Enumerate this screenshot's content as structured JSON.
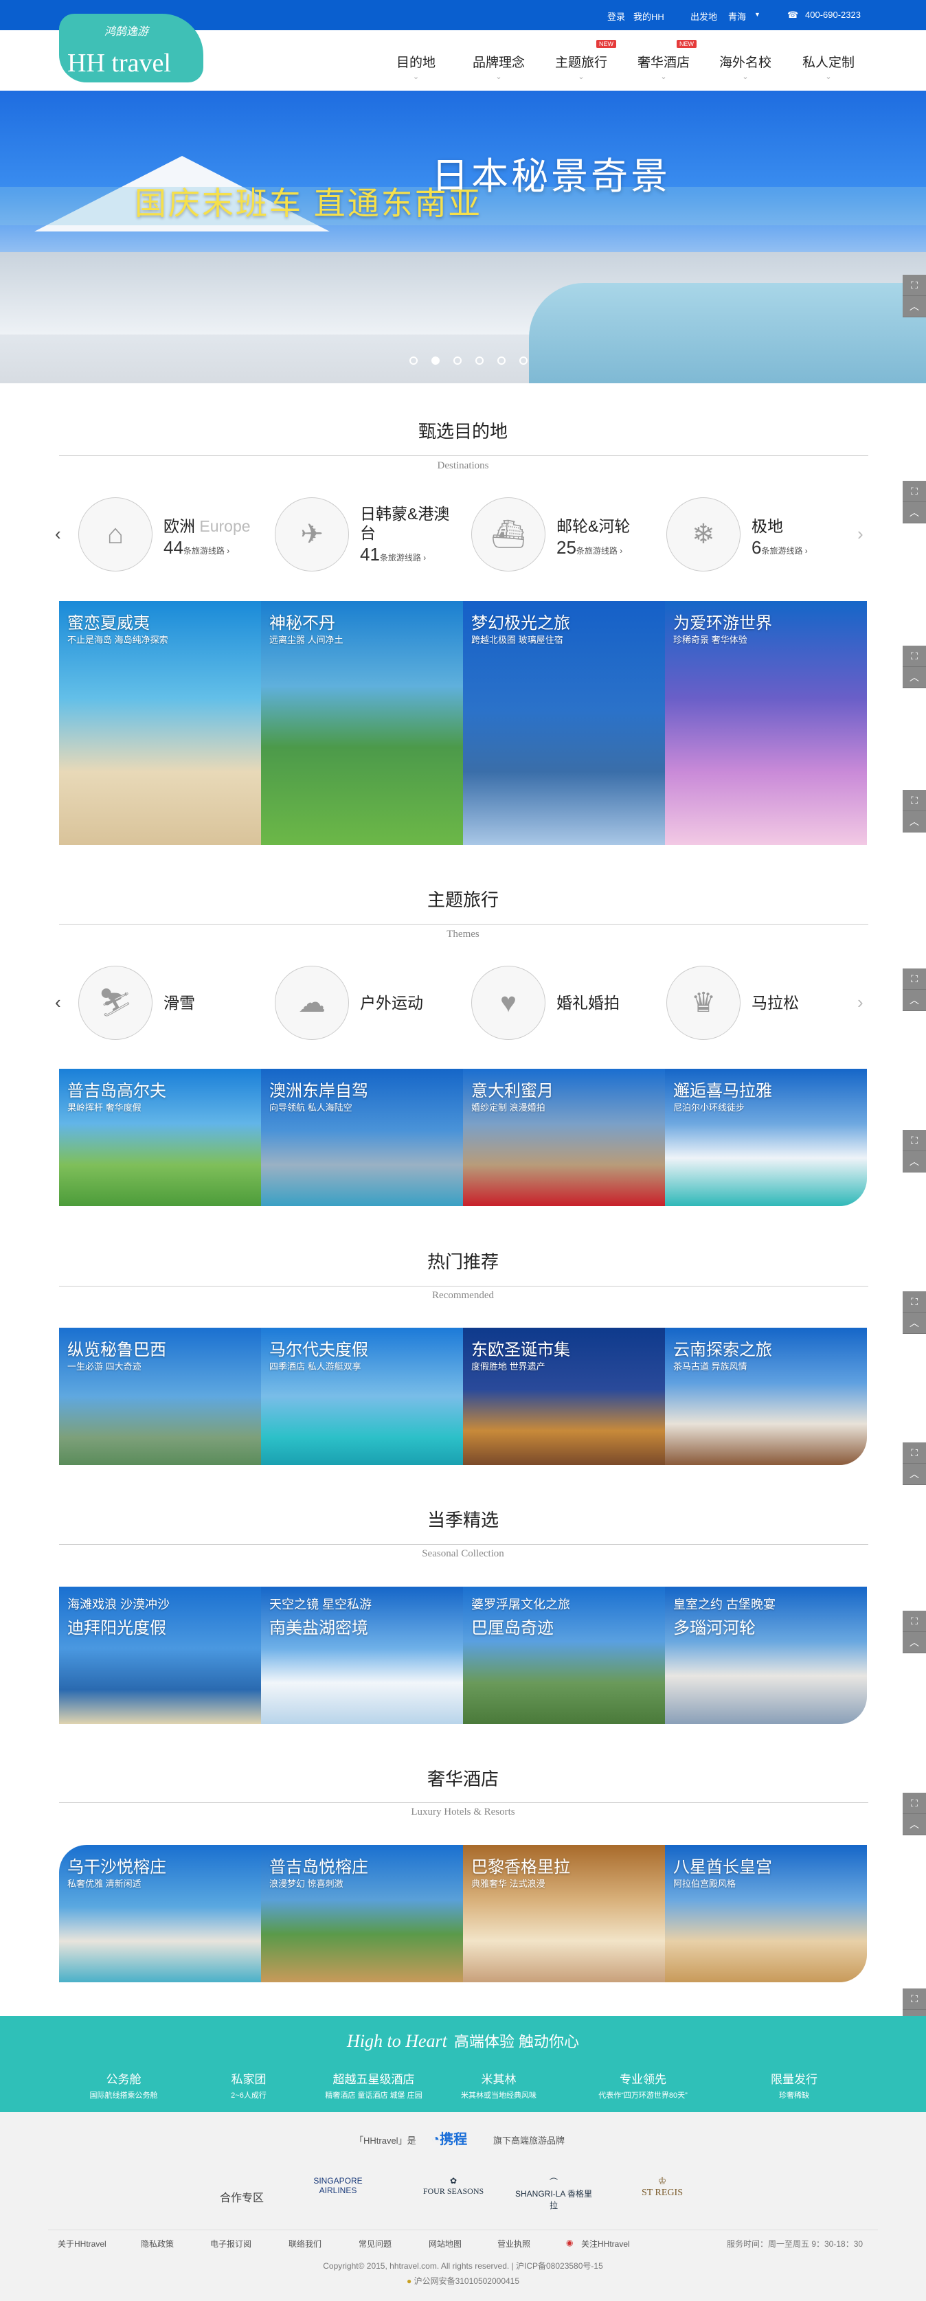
{
  "header": {
    "login": "登录",
    "my_hh": "我的HH",
    "departure": "出发地",
    "city": "青海",
    "phone": "400-690-2323",
    "logo_cn": "鸿鹄逸游",
    "logo_en": "HH travel",
    "badge": "NEW"
  },
  "nav": [
    "目的地",
    "品牌理念",
    "主题旅行",
    "奢华酒店",
    "海外名校",
    "私人定制"
  ],
  "banner": {
    "title": "日本秘景奇景",
    "subtitle": "国庆末班车  直通东南亚"
  },
  "sections": {
    "dest": {
      "title": "甄选目的地",
      "sub": "Destinations"
    },
    "theme": {
      "title": "主题旅行",
      "sub": "Themes"
    },
    "rec": {
      "title": "热门推荐",
      "sub": "Recommended"
    },
    "season": {
      "title": "当季精选",
      "sub": "Seasonal Collection"
    },
    "hotel": {
      "title": "奢华酒店",
      "sub": "Luxury Hotels & Resorts"
    }
  },
  "dest_cats": [
    {
      "name": "欧洲",
      "en": "Europe",
      "count": "44",
      "unit": "条旅游线路 ›"
    },
    {
      "name": "日韩蒙&港澳台",
      "en": "",
      "count": "41",
      "unit": "条旅游线路 ›"
    },
    {
      "name": "邮轮&河轮",
      "en": "",
      "count": "25",
      "unit": "条旅游线路 ›"
    },
    {
      "name": "极地",
      "en": "",
      "count": "6",
      "unit": "条旅游线路 ›"
    }
  ],
  "dest_tiles": [
    {
      "t": "蜜恋夏威夷",
      "s": "不止是海岛 海岛纯净探索"
    },
    {
      "t": "神秘不丹",
      "s": "远离尘嚣 人间净土"
    },
    {
      "t": "梦幻极光之旅",
      "s": "跨越北极圈 玻璃屋住宿"
    },
    {
      "t": "为爱环游世界",
      "s": "珍稀奇景 奢华体验"
    }
  ],
  "theme_cats": [
    "滑雪",
    "户外运动",
    "婚礼婚拍",
    "马拉松"
  ],
  "theme_tiles": [
    {
      "t": "普吉岛高尔夫",
      "s": "果岭挥杆 奢华度假"
    },
    {
      "t": "澳洲东岸自驾",
      "s": "向导领航 私人海陆空"
    },
    {
      "t": "意大利蜜月",
      "s": "婚纱定制 浪漫婚拍"
    },
    {
      "t": "邂逅喜马拉雅",
      "s": "尼泊尔小环线徒步"
    }
  ],
  "rec_tiles": [
    {
      "t": "纵览秘鲁巴西",
      "s": "一生必游 四大奇迹"
    },
    {
      "t": "马尔代夫度假",
      "s": "四季酒店 私人游艇双享"
    },
    {
      "t": "东欧圣诞市集",
      "s": "度假胜地 世界遗产"
    },
    {
      "t": "云南探索之旅",
      "s": "茶马古道 异族风情"
    }
  ],
  "season_tiles": [
    {
      "s": "海滩戏浪 沙漠冲沙",
      "t": "迪拜阳光度假"
    },
    {
      "s": "天空之镜 星空私游",
      "t": "南美盐湖密境"
    },
    {
      "s": "婆罗浮屠文化之旅",
      "t": "巴厘岛奇迹"
    },
    {
      "s": "皇室之约 古堡晚宴",
      "t": "多瑙河河轮"
    }
  ],
  "hotel_tiles": [
    {
      "t": "乌干沙悦榕庄",
      "s": "私奢优雅 清新闲适"
    },
    {
      "t": "普吉岛悦榕庄",
      "s": "浪漫梦幻 惊喜刺激"
    },
    {
      "t": "巴黎香格里拉",
      "s": "典雅奢华 法式浪漫"
    },
    {
      "t": "八星酋长皇宫",
      "s": "阿拉伯宫殿风格"
    }
  ],
  "band": {
    "slogan_en": "High  to  Heart",
    "slogan_cn": "高端体验  触动你心",
    "features": [
      {
        "a": "公务舱",
        "b": "国际航线搭乘公务舱"
      },
      {
        "a": "私家团",
        "b": "2~6人成行"
      },
      {
        "a": "超越五星级酒店",
        "b": "精奢酒店 童话酒店 城堡 庄园"
      },
      {
        "a": "米其林",
        "b": "米其林或当地经典风味"
      },
      {
        "a": "专业领先",
        "b": "代表作“四万环游世界80天”"
      },
      {
        "a": "限量发行",
        "b": "珍奢稀缺"
      }
    ]
  },
  "footer": {
    "ctrip_pre": "「HHtravel」是",
    "ctrip": "携程",
    "ctrip_post": "旗下高端旅游品牌",
    "partners_label": "合作专区",
    "partners": [
      "SINGAPORE AIRLINES",
      "FOUR SEASONS",
      "SHANGRI-LA 香格里拉",
      "ST REGIS"
    ],
    "links": [
      "关于HHtravel",
      "隐私政策",
      "电子报订阅",
      "联络我们",
      "常见问题",
      "网站地图",
      "营业执照",
      "关注HHtravel"
    ],
    "hours": "服务时间：周一至周五 9：30-18：30",
    "copyright": "Copyright© 2015, hhtravel.com. All rights reserved. | 沪ICP备08023580号-15",
    "police": "沪公网安备31010502000415"
  },
  "colors": {
    "topbar": "#0a5fcf",
    "teal": "#2fc0b8",
    "brand": "#3fc0b6"
  }
}
